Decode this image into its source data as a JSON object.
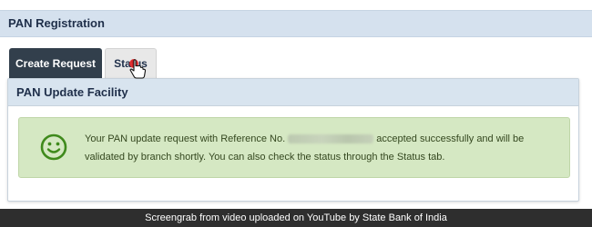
{
  "header": {
    "title": "PAN Registration"
  },
  "tabs": [
    {
      "label": "Create Request",
      "active": true
    },
    {
      "label": "Status",
      "active": false
    }
  ],
  "panel": {
    "title": "PAN Update Facility",
    "message": {
      "before_ref": "Your PAN update request with Reference No.",
      "after_ref": "accepted successfully and will be",
      "line2": "validated by branch shortly. You can also check the status through the Status tab."
    },
    "icon": "smiley-icon"
  },
  "caption": "Screengrab from video uploaded on YouTube by State Bank of India",
  "colors": {
    "header_bg": "#d5e1ee",
    "active_tab": "#323f4c",
    "alert_bg": "#d5e8c3",
    "alert_text": "#34471f",
    "caption_bg": "#2e2e2e"
  }
}
